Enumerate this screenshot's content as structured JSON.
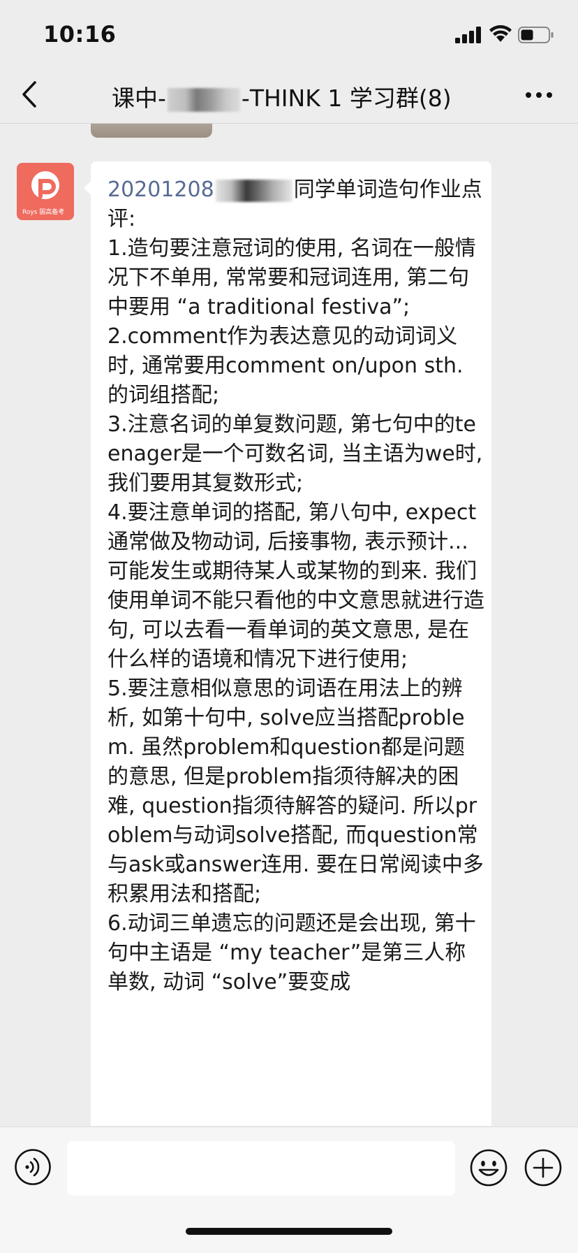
{
  "status_bar": {
    "time": "10:16"
  },
  "nav": {
    "title_prefix": "课中-",
    "title_suffix": "-THINK 1 学习群(8)"
  },
  "message": {
    "sender_avatar_text": "Roys 国高备考",
    "date_prefix": "20201208",
    "intro_suffix": "同学单词造句作业点评:",
    "body": "\n1.造句要注意冠词的使用, 名词在一般情况下不单用, 常常要和冠词连用, 第二句中要用 “a traditional festiva”;\n2.comment作为表达意见的动词词义时, 通常要用comment on/upon sth. 的词组搭配;\n3.注意名词的单复数问题, 第七句中的teenager是一个可数名词, 当主语为we时, 我们要用其复数形式;\n4.要注意单词的搭配, 第八句中, expect通常做及物动词, 后接事物, 表示预计...可能发生或期待某人或某物的到来. 我们使用单词不能只看他的中文意思就进行造句, 可以去看一看单词的英文意思, 是在什么样的语境和情况下进行使用;\n5.要注意相似意思的词语在用法上的辨析, 如第十句中, solve应当搭配problem. 虽然problem和question都是问题的意思, 但是problem指须待解决的困难, question指须待解答的疑问. 所以problem与动词solve搭配, 而question常与ask或answer连用. 要在日常阅读中多积累用法和搭配;\n6.动词三单遗忘的问题还是会出现, 第十句中主语是 “my teacher”是第三人称单数, 动词 “solve”要变成"
  },
  "input": {
    "placeholder": ""
  }
}
